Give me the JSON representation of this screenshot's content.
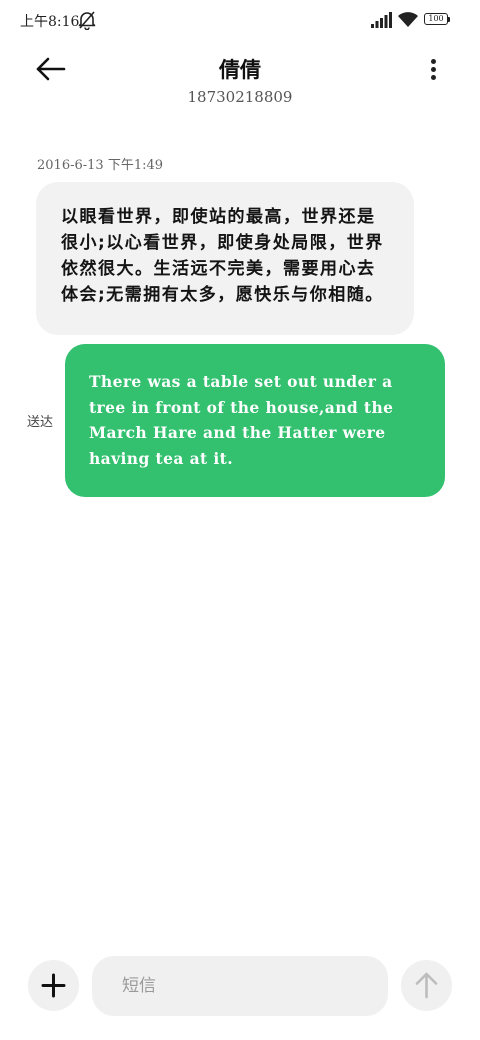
{
  "status_bar": {
    "time": "上午8:16",
    "battery": "100",
    "icons": [
      "do-not-disturb-icon",
      "signal-icon",
      "wifi-icon",
      "battery-icon"
    ]
  },
  "header": {
    "contact_name": "倩倩",
    "phone_number": "18730218809",
    "icons": [
      "back-arrow-icon",
      "more-vertical-icon"
    ]
  },
  "conversation": {
    "timestamp": "2016-6-13 下午1:49",
    "received_message": "以眼看世界，即使站的最高，世界还是很小;以心看世界，即使身处局限，世界依然很大。生活远不完美，需要用心去体会;无需拥有太多，愿快乐与你相随。",
    "sent_message": "There was a table set out under a tree in front of the house,and the March Hare and the Hatter were having tea at it.",
    "sent_status": "送达"
  },
  "composer": {
    "placeholder": "短信",
    "icons": [
      "plus-icon",
      "send-arrow-icon"
    ]
  },
  "colors": {
    "sent_bubble": "#33c06f",
    "received_bubble": "#f2f2f2",
    "composer_background": "#f0f0f0"
  }
}
